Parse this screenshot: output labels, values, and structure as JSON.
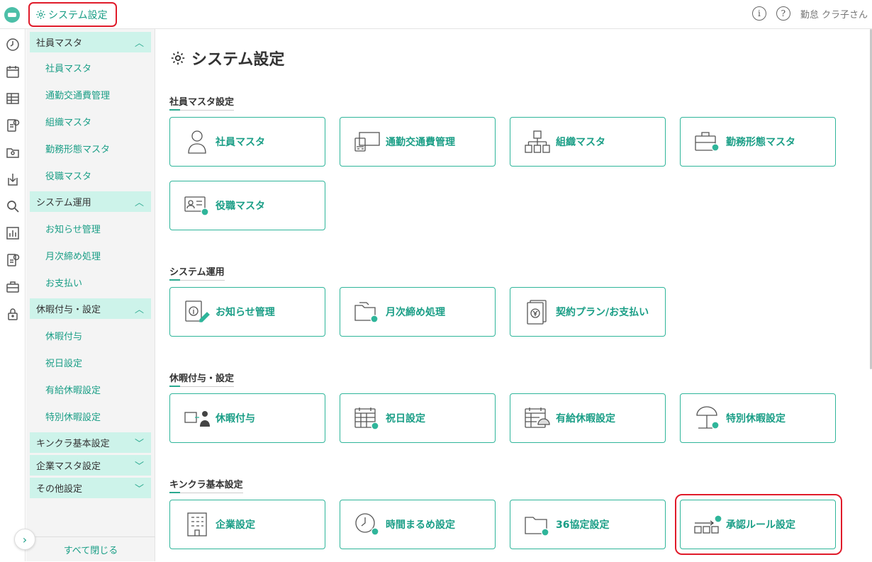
{
  "header": {
    "crumb": "システム設定",
    "user": "勤怠 クラ子さん",
    "info_icon": "info-icon",
    "help_icon": "help-icon"
  },
  "sidebar": {
    "sections": [
      {
        "label": "社員マスタ",
        "expanded": true,
        "items": [
          "社員マスタ",
          "通勤交通費管理",
          "組織マスタ",
          "勤務形態マスタ",
          "役職マスタ"
        ]
      },
      {
        "label": "システム運用",
        "expanded": true,
        "items": [
          "お知らせ管理",
          "月次締め処理",
          "お支払い"
        ]
      },
      {
        "label": "休暇付与・設定",
        "expanded": true,
        "items": [
          "休暇付与",
          "祝日設定",
          "有給休暇設定",
          "特別休暇設定"
        ]
      },
      {
        "label": "キンクラ基本設定",
        "expanded": false,
        "items": []
      },
      {
        "label": "企業マスタ設定",
        "expanded": false,
        "items": []
      },
      {
        "label": "その他設定",
        "expanded": false,
        "items": []
      }
    ],
    "close_all": "すべて閉じる"
  },
  "main": {
    "title": "システム設定",
    "groups": [
      {
        "label": "社員マスタ設定",
        "cards": [
          "社員マスタ",
          "通勤交通費管理",
          "組織マスタ",
          "勤務形態マスタ",
          "役職マスタ"
        ]
      },
      {
        "label": "システム運用",
        "cards": [
          "お知らせ管理",
          "月次締め処理",
          "契約プラン/お支払い"
        ]
      },
      {
        "label": "休暇付与・設定",
        "cards": [
          "休暇付与",
          "祝日設定",
          "有給休暇設定",
          "特別休暇設定"
        ]
      },
      {
        "label": "キンクラ基本設定",
        "cards": [
          "企業設定",
          "時間まるめ設定",
          "36協定設定",
          "承認ルール設定"
        ]
      }
    ]
  },
  "colors": {
    "accent": "#1a9e86",
    "accent_light": "#cdf3ea",
    "highlight": "#e01b2a"
  }
}
